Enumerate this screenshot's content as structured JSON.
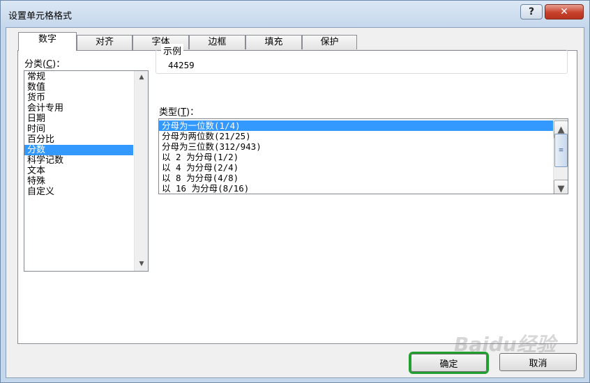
{
  "window": {
    "title": "设置单元格格式",
    "help_label": "?",
    "close_label": "✕"
  },
  "tabs": [
    {
      "label": "数字",
      "active": true
    },
    {
      "label": "对齐",
      "active": false
    },
    {
      "label": "字体",
      "active": false
    },
    {
      "label": "边框",
      "active": false
    },
    {
      "label": "填充",
      "active": false
    },
    {
      "label": "保护",
      "active": false
    }
  ],
  "category": {
    "label_prefix": "分类(",
    "label_key": "C",
    "label_suffix": ")：",
    "items": [
      "常规",
      "数值",
      "货币",
      "会计专用",
      "日期",
      "时间",
      "百分比",
      "分数",
      "科学记数",
      "文本",
      "特殊",
      "自定义"
    ],
    "selected_index": 7
  },
  "sample": {
    "legend": "示例",
    "value": "44259"
  },
  "type": {
    "label_prefix": "类型(",
    "label_key": "T",
    "label_suffix": ")：",
    "items": [
      "分母为一位数(1/4)",
      "分母为两位数(21/25)",
      "分母为三位数(312/943)",
      "以 2 为分母(1/2)",
      "以 4 为分母(2/4)",
      "以 8 为分母(4/8)",
      "以 16 为分母(8/16)"
    ],
    "selected_index": 0
  },
  "buttons": {
    "ok": "确定",
    "cancel": "取消"
  },
  "icons": {
    "up": "scroll-up-icon",
    "down": "scroll-down-icon",
    "grip": "scroll-grip-icon"
  },
  "watermark": "Baidu经验",
  "colors": {
    "selection": "#3399ff",
    "ok_highlight": "#22a02f",
    "close": "#c7412b"
  }
}
